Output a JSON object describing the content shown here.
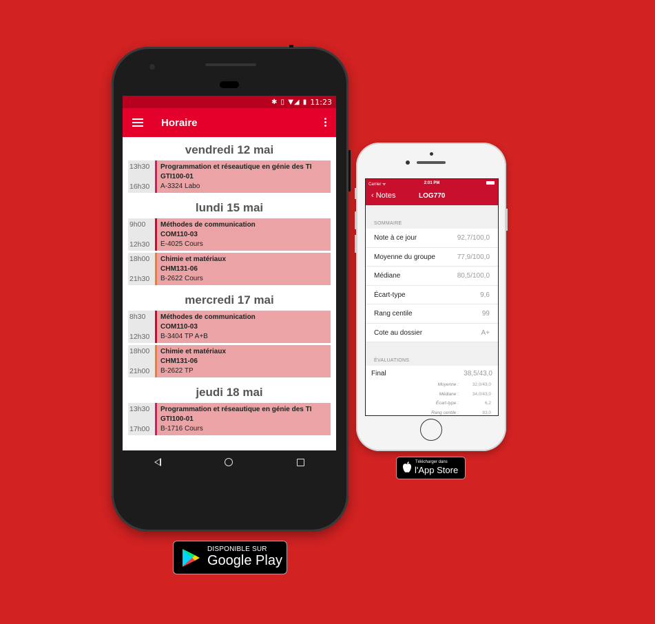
{
  "android": {
    "status_time": "11:23",
    "status_icons": "✱ ▯ ▼◢ ▮",
    "appbar_title": "Horaire",
    "days": [
      {
        "label": "vendredi 12 mai",
        "courses": [
          {
            "start": "13h30",
            "end": "16h30",
            "name": "Programmation et réseautique en génie des TI",
            "code": "GTI100-01",
            "room": "A-3324 Labo",
            "color": "#e0165c"
          }
        ]
      },
      {
        "label": "lundi 15 mai",
        "courses": [
          {
            "start": "9h00",
            "end": "12h30",
            "name": "Méthodes de communication",
            "code": "COM110-03",
            "room": "E-4025 Cours",
            "color": "#e4002b"
          },
          {
            "start": "18h00",
            "end": "21h30",
            "name": "Chimie et matériaux",
            "code": "CHM131-06",
            "room": "B-2622 Cours",
            "color": "#f47c20"
          }
        ]
      },
      {
        "label": "mercredi 17 mai",
        "courses": [
          {
            "start": "8h30",
            "end": "12h30",
            "name": "Méthodes de communication",
            "code": "COM110-03",
            "room": "B-3404 TP A+B",
            "color": "#e4002b"
          },
          {
            "start": "18h00",
            "end": "21h00",
            "name": "Chimie et matériaux",
            "code": "CHM131-06",
            "room": "B-2622 TP",
            "color": "#f47c20"
          }
        ]
      },
      {
        "label": "jeudi 18 mai",
        "courses": [
          {
            "start": "13h30",
            "end": "17h00",
            "name": "Programmation et réseautique en génie des TI",
            "code": "GTI100-01",
            "room": "B-1716 Cours",
            "color": "#e0165c"
          }
        ]
      }
    ]
  },
  "google_play": {
    "small": "DISPONIBLE SUR",
    "big": "Google Play"
  },
  "iphone": {
    "carrier": "Carrier ᯤ",
    "time": "2:01 PM",
    "back_label": "Notes",
    "title": "LOG770",
    "summary_header": "SOMMAIRE",
    "summary_rows": [
      {
        "label": "Note à ce jour",
        "value": "92,7/100,0"
      },
      {
        "label": "Moyenne du groupe",
        "value": "77,9/100,0"
      },
      {
        "label": "Médiane",
        "value": "80,5/100,0"
      },
      {
        "label": "Écart-type",
        "value": "9,6"
      },
      {
        "label": "Rang centile",
        "value": "99"
      },
      {
        "label": "Cote au dossier",
        "value": "A+"
      }
    ],
    "evaluations_header": "ÉVALUATIONS",
    "evaluation": {
      "name": "Final",
      "total": "38,5/43,0",
      "stats": [
        {
          "label": "Moyenne :",
          "value": "32,0/43,0"
        },
        {
          "label": "Médiane :",
          "value": "34,0/43,0"
        },
        {
          "label": "Écart-type :",
          "value": "6,2"
        },
        {
          "label": "Rang centile :",
          "value": "83,0"
        }
      ]
    }
  },
  "app_store": {
    "small": "Télécharger dans",
    "big": "l'App Store"
  }
}
